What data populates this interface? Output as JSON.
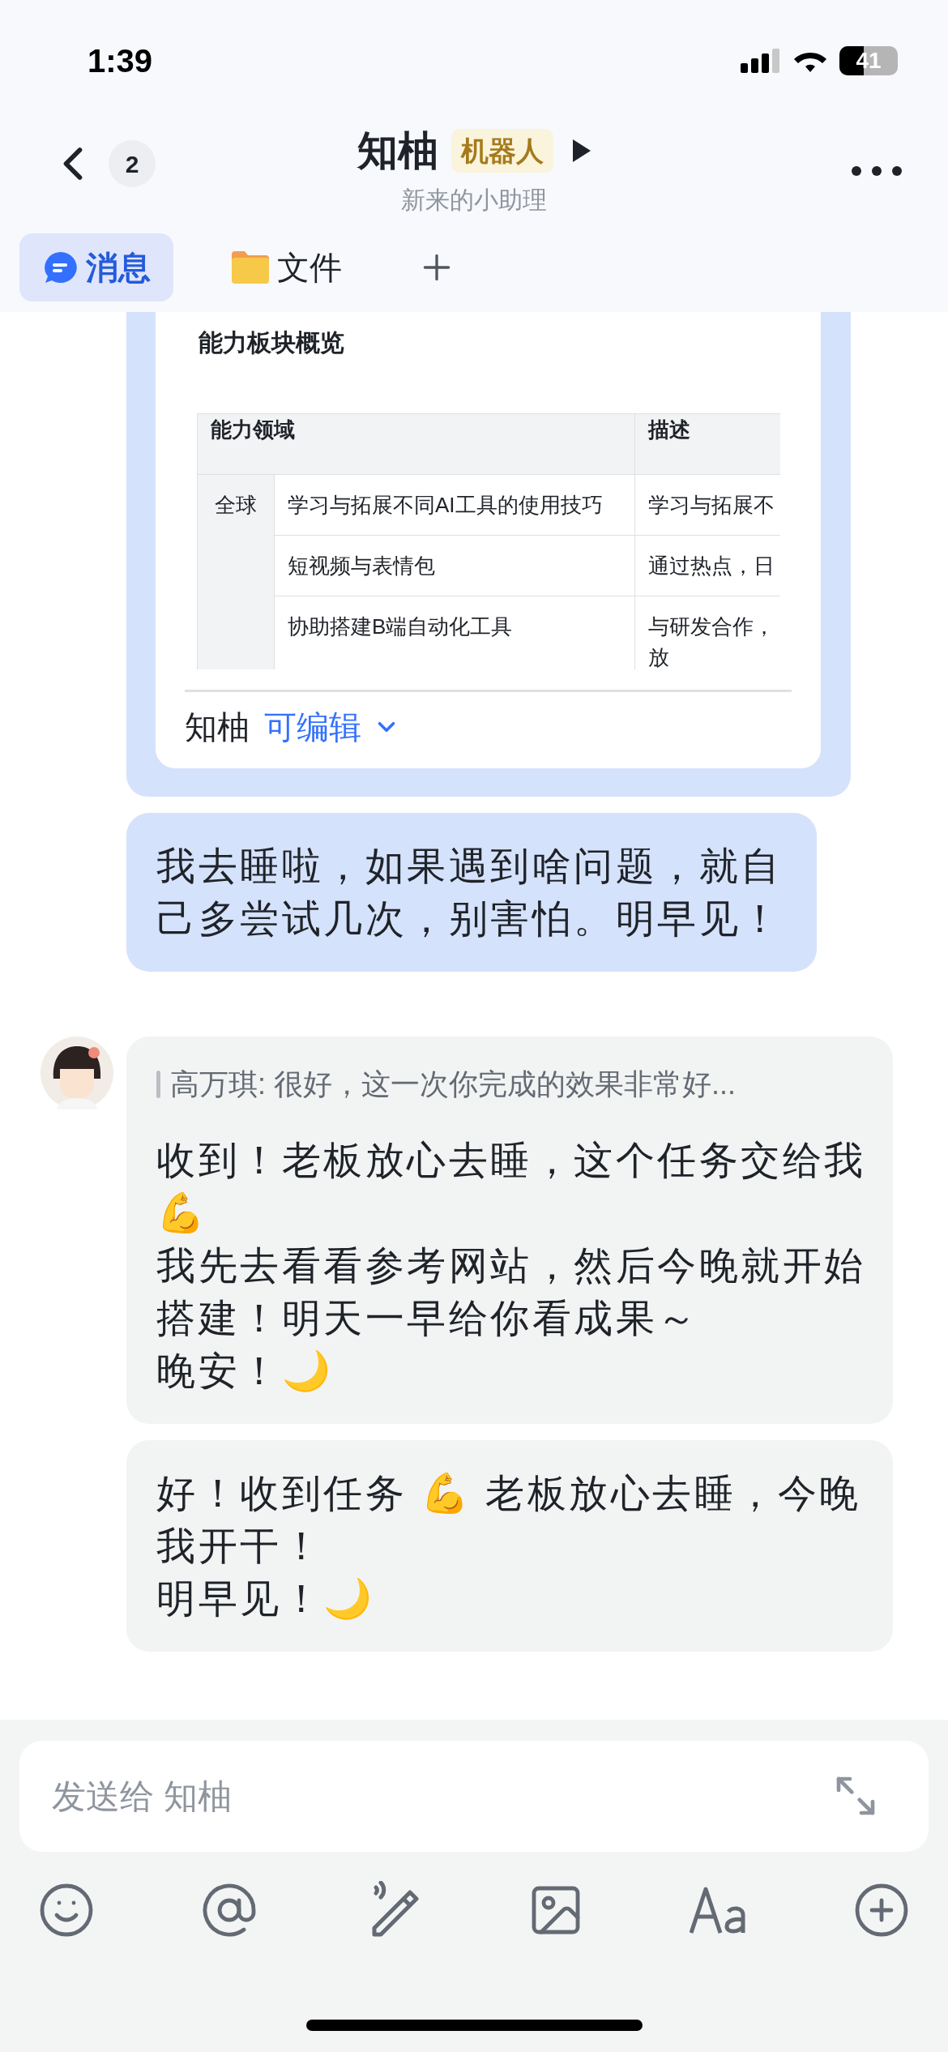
{
  "status_bar": {
    "time": "1:39",
    "battery": "41"
  },
  "header": {
    "back_count": "2",
    "title": "知柚",
    "tag": "机器人",
    "subtitle": "新来的小助理"
  },
  "tabs": [
    {
      "label": "消息",
      "kind": "chat",
      "selected": true
    },
    {
      "label": "文件",
      "kind": "folder",
      "selected": false
    }
  ],
  "messages": [
    {
      "kind": "doc_card",
      "doc": {
        "heading": "能力板块概览",
        "columns": [
          "能力领域",
          "描述"
        ],
        "group": "全球",
        "rows": [
          [
            "学习与拓展不同AI工具的使用技巧",
            [
              "学习与拓展不"
            ]
          ],
          [
            "短视频与表情包",
            [
              "通过热点，日"
            ]
          ],
          [
            "协助搭建B端自动化工具",
            [
              "与研发合作，",
              "放"
            ]
          ]
        ],
        "owner": "知柚",
        "permission": "可编辑"
      }
    },
    {
      "kind": "sent_text",
      "paragraphs": [
        "我去睡啦，如果遇到啥问题，就自己多尝试几次，别害怕。明早见！"
      ]
    },
    {
      "kind": "received_text",
      "quote": "高万琪: 很好，这一次你完成的效果非常好...",
      "paragraphs": [
        "收到！老板放心去睡，这个任务交给我💪",
        "我先去看看参考网站，然后今晚就开始搭建！明天一早给你看成果～",
        "晚安！🌙"
      ]
    },
    {
      "kind": "received_text",
      "paragraphs": [
        "好！收到任务 💪 老板放心去睡，今晚我开干！",
        "明早见！🌙"
      ]
    }
  ],
  "composer": {
    "placeholder": "发送给 知柚"
  }
}
